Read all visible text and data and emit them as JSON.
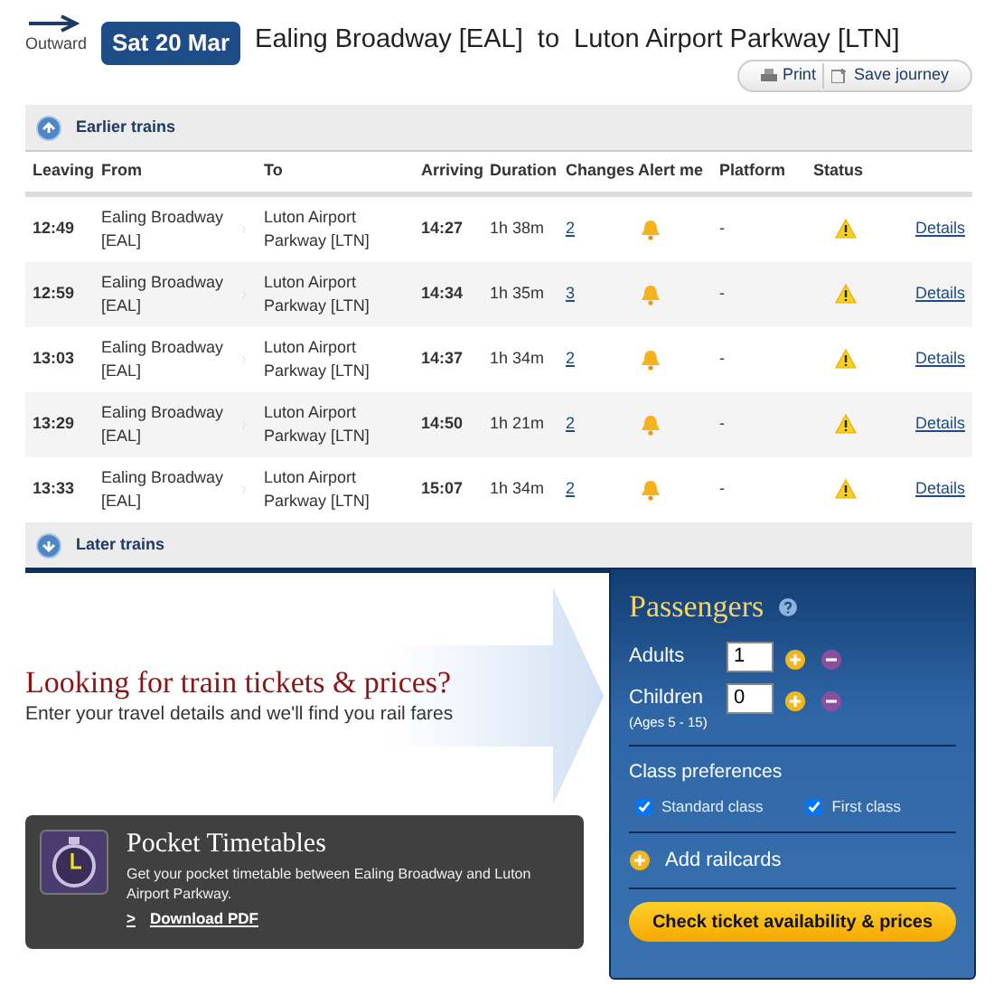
{
  "journey": {
    "direction": "Outward",
    "date": "Sat 20 Mar",
    "route": "Ealing Broadway [EAL]  to  Luton Airport Parkway [LTN]"
  },
  "actions": [
    {
      "kind": "print",
      "label": "Print"
    },
    {
      "kind": "save",
      "label": "Save journey"
    }
  ],
  "earlier": "Earlier trains",
  "columns": [
    "Leaving",
    "From",
    "To",
    "Arriving",
    "Duration",
    "Changes",
    "Alert me",
    "Platform",
    "Status"
  ],
  "rows": [
    {
      "leaving": "12:49",
      "from": "Ealing Broadway [EAL]",
      "to": "Luton Airport Parkway [LTN]",
      "arriving": "14:27",
      "duration": "1h 38m",
      "changes": "2",
      "platform": "-",
      "details": "Details"
    },
    {
      "leaving": "12:59",
      "from": "Ealing Broadway [EAL]",
      "to": "Luton Airport Parkway [LTN]",
      "arriving": "14:34",
      "duration": "1h 35m",
      "changes": "3",
      "platform": "-",
      "details": "Details"
    },
    {
      "leaving": "13:03",
      "from": "Ealing Broadway [EAL]",
      "to": "Luton Airport Parkway [LTN]",
      "arriving": "14:37",
      "duration": "1h 34m",
      "changes": "2",
      "platform": "-",
      "details": "Details"
    },
    {
      "leaving": "13:29",
      "from": "Ealing Broadway [EAL]",
      "to": "Luton Airport Parkway [LTN]",
      "arriving": "14:50",
      "duration": "1h 21m",
      "changes": "2",
      "platform": "-",
      "details": "Details"
    },
    {
      "leaving": "13:33",
      "from": "Ealing Broadway [EAL]",
      "to": "Luton Airport Parkway [LTN]",
      "arriving": "15:07",
      "duration": "1h 34m",
      "changes": "2",
      "platform": "-",
      "details": "Details"
    }
  ],
  "later": "Later trains",
  "promo": {
    "title": "Looking for train tickets & prices?",
    "text": "Enter your travel details and we'll find you rail fares"
  },
  "pocket": {
    "title": "Pocket Timetables",
    "text": "Get your pocket timetable between Ealing Broadway and Luton Airport Parkway.",
    "link_marker": ">",
    "link": "Download PDF"
  },
  "passengers": {
    "title": "Passengers",
    "counters": [
      {
        "label": "Adults",
        "value": "1"
      },
      {
        "label": "Children",
        "note": "(Ages 5 - 15)",
        "value": "0"
      }
    ],
    "class_title": "Class preferences",
    "classes": [
      {
        "label": "Standard class",
        "checked": true
      },
      {
        "label": "First class",
        "checked": true
      }
    ],
    "railcards": "Add railcards",
    "submit": "Check ticket availability & prices"
  }
}
